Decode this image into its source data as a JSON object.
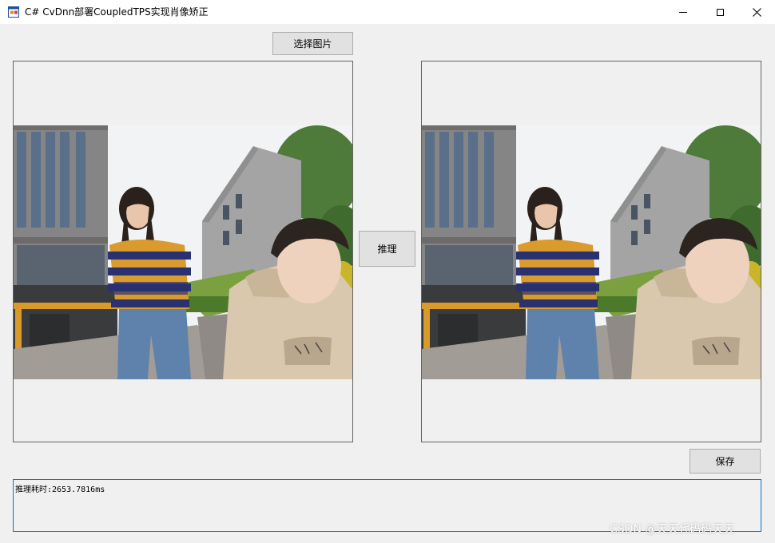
{
  "window": {
    "title": "C# CvDnn部署CoupledTPS实现肖像矫正",
    "icons": {
      "app": "app-window-icon",
      "minimize": "minimize-icon",
      "maximize": "maximize-icon",
      "close": "close-icon"
    }
  },
  "toolbar": {
    "select_image_label": "选择图片",
    "infer_label": "推理",
    "save_label": "保存"
  },
  "images": {
    "input": "portrait-photo-input",
    "output": "portrait-photo-corrected"
  },
  "output": {
    "text": "推理耗时:2653.7816ms"
  },
  "watermark": "CSDN @天天代码码天天",
  "colors": {
    "textbox_border": "#0078d7",
    "button_face": "#e1e1e1",
    "window_bg": "#f0f0f0"
  }
}
